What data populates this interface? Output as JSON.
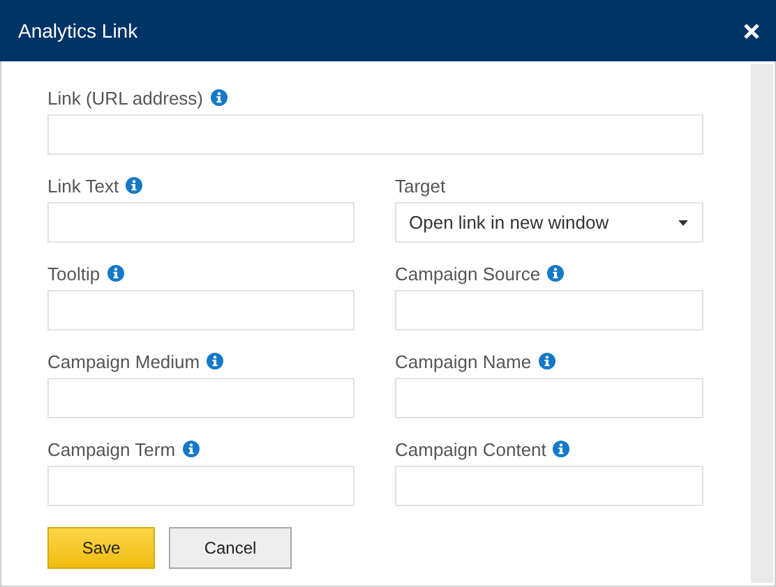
{
  "window": {
    "title": "Analytics Link"
  },
  "link_field": {
    "label": "Link (URL address)",
    "kind": "text",
    "info": true
  },
  "fields": [
    {
      "label": "Link Text",
      "kind": "text",
      "info": true
    },
    {
      "label": "Target",
      "kind": "select",
      "info": false,
      "value": "Open link in new window"
    },
    {
      "label": "Tooltip",
      "kind": "text",
      "info": true
    },
    {
      "label": "Campaign Source",
      "kind": "text",
      "info": true
    },
    {
      "label": "Campaign Medium",
      "kind": "text",
      "info": true
    },
    {
      "label": "Campaign Name",
      "kind": "text",
      "info": true
    },
    {
      "label": "Campaign Term",
      "kind": "text",
      "info": true
    },
    {
      "label": "Campaign Content",
      "kind": "text",
      "info": true
    }
  ],
  "buttons": [
    {
      "label": "Save",
      "kind": "primary"
    },
    {
      "label": "Cancel",
      "kind": "secondary"
    }
  ]
}
